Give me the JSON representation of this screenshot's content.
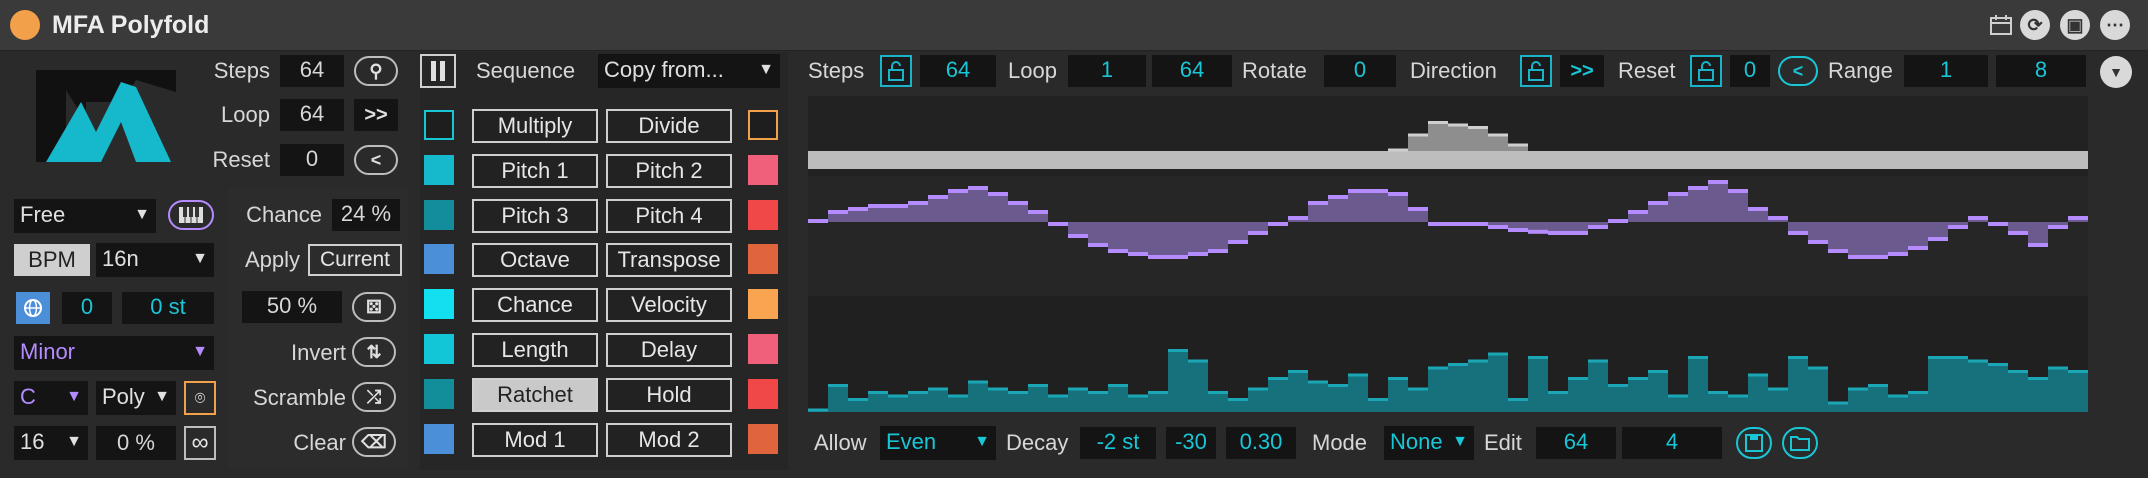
{
  "title": "MFA Polyfold",
  "titlebar_icons": [
    "calendar-icon",
    "refresh-icon",
    "save-icon",
    "more-icon"
  ],
  "colors": {
    "accent_cyan": "#19c6d6",
    "accent_purple": "#b58cff",
    "title_dot": "#f3a04a"
  },
  "left": {
    "steps_label": "Steps",
    "steps_value": "64",
    "loop_label": "Loop",
    "loop_value": "64",
    "loop_btn": ">>",
    "reset_label": "Reset",
    "reset_value": "0",
    "reset_btn": "<",
    "clock_mode": "Free",
    "bpm_label": "BPM",
    "rate": "16n",
    "transpose_value": "0",
    "transpose_st": "0 st",
    "scale": "Minor",
    "root": "C",
    "voice_mode": "Poly",
    "div_value": "16",
    "pct_value": "0 %",
    "chance_label": "Chance",
    "chance_value": "24 %",
    "apply_label": "Apply",
    "apply_value": "Current",
    "prob_value": "50 %",
    "invert_label": "Invert",
    "scramble_label": "Scramble",
    "clear_label": "Clear"
  },
  "sequence": {
    "label": "Sequence",
    "copy_from": "Copy from...",
    "left_buttons": [
      "Multiply",
      "Pitch 1",
      "Pitch 3",
      "Octave",
      "Chance",
      "Length",
      "Ratchet",
      "Mod 1"
    ],
    "right_buttons": [
      "Divide",
      "Pitch 2",
      "Pitch 4",
      "Transpose",
      "Velocity",
      "Delay",
      "Hold",
      "Mod 2"
    ],
    "left_swatches": [
      "#1e1e1e",
      "#16b8cc",
      "#138d9c",
      "#4a8fd8",
      "#12e0f0",
      "#12c6d8",
      "#128d9a",
      "#4a8fd8"
    ],
    "right_swatches": [
      "#1e1e1e",
      "#f0607a",
      "#f04848",
      "#e0643c",
      "#f8a450",
      "#f0607a",
      "#f04848",
      "#e0643c"
    ],
    "active": "Ratchet"
  },
  "top": {
    "steps_label": "Steps",
    "steps_value": "64",
    "loop_label": "Loop",
    "loop_start": "1",
    "loop_end": "64",
    "rotate_label": "Rotate",
    "rotate_value": "0",
    "direction_label": "Direction",
    "direction_btn": ">>",
    "reset_label": "Reset",
    "reset_value": "0",
    "reset_btn": "<",
    "range_label": "Range",
    "range_start": "1",
    "range_end": "8"
  },
  "bottom": {
    "allow_label": "Allow",
    "allow_value": "Even",
    "decay_label": "Decay",
    "decay_st": "-2 st",
    "decay_a": "-30",
    "decay_b": "0.30",
    "mode_label": "Mode",
    "mode_value": "None",
    "edit_label": "Edit",
    "edit_a": "64",
    "edit_b": "4"
  },
  "chart_data": {
    "type": "bar",
    "steps": 64,
    "series": [
      {
        "color": "#8e8e8e",
        "values": [
          0,
          0,
          0,
          0,
          0,
          0,
          0,
          0,
          0,
          0,
          0,
          0,
          0,
          0,
          0,
          0,
          0,
          0,
          0,
          0,
          0,
          0,
          0,
          0,
          0,
          0,
          0,
          0,
          0,
          0.05,
          0.35,
          0.6,
          0.55,
          0.5,
          0.35,
          0.15,
          0,
          0,
          0,
          0,
          0,
          0,
          0,
          0,
          0,
          0,
          0,
          0,
          0,
          0,
          0,
          0,
          0,
          0,
          0,
          0,
          0,
          0,
          0,
          0,
          0,
          0,
          0,
          0
        ]
      },
      {
        "color": "#b58cff",
        "values": [
          0.05,
          0.2,
          0.25,
          0.3,
          0.3,
          0.35,
          0.45,
          0.55,
          0.6,
          0.5,
          0.35,
          0.2,
          -0.05,
          -0.25,
          -0.4,
          -0.5,
          -0.55,
          -0.6,
          -0.6,
          -0.55,
          -0.5,
          -0.35,
          -0.2,
          -0.05,
          0.1,
          0.35,
          0.45,
          0.55,
          0.55,
          0.5,
          0.25,
          0.0,
          -0.05,
          -0.05,
          -0.1,
          -0.15,
          -0.18,
          -0.2,
          -0.2,
          -0.1,
          0.05,
          0.2,
          0.35,
          0.5,
          0.6,
          0.7,
          0.55,
          0.25,
          0.1,
          -0.2,
          -0.35,
          -0.5,
          -0.6,
          -0.6,
          -0.55,
          -0.45,
          -0.3,
          -0.1,
          0.1,
          -0.05,
          -0.2,
          -0.4,
          -0.1,
          0.1
        ]
      },
      {
        "color": "#16717c",
        "values": [
          0.05,
          0.4,
          0.2,
          0.3,
          0.25,
          0.3,
          0.35,
          0.25,
          0.45,
          0.35,
          0.3,
          0.4,
          0.25,
          0.35,
          0.3,
          0.4,
          0.25,
          0.3,
          0.9,
          0.75,
          0.3,
          0.2,
          0.35,
          0.5,
          0.6,
          0.45,
          0.4,
          0.55,
          0.2,
          0.5,
          0.35,
          0.65,
          0.7,
          0.75,
          0.85,
          0.2,
          0.8,
          0.3,
          0.5,
          0.75,
          0.4,
          0.5,
          0.6,
          0.25,
          0.8,
          0.3,
          0.25,
          0.55,
          0.35,
          0.8,
          0.65,
          0.15,
          0.35,
          0.4,
          0.25,
          0.3,
          0.8,
          0.8,
          0.75,
          0.7,
          0.6,
          0.5,
          0.65,
          0.6
        ]
      }
    ]
  }
}
